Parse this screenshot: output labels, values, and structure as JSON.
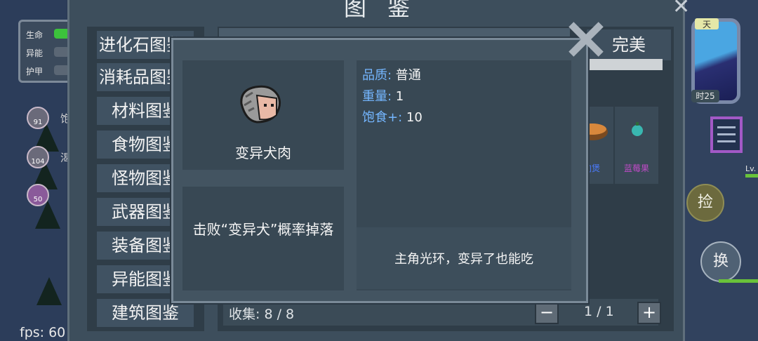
{
  "hud": {
    "status": [
      {
        "label": "生命",
        "color": "#3cc23c"
      },
      {
        "label": "异能",
        "color": "#5b6775"
      },
      {
        "label": "护甲",
        "color": "#5b6775"
      }
    ],
    "buffs": [
      {
        "value": "91",
        "side": "饱"
      },
      {
        "value": "104",
        "side": "渴"
      },
      {
        "value": "50",
        "side": ""
      }
    ],
    "fps": "fps: 60",
    "clock_top": "天",
    "clock_bottom": "时25",
    "pick_label": "捡",
    "swap_label": "换",
    "level_label": "Lv."
  },
  "codex": {
    "title": "图鉴",
    "categories": [
      "进化石图鉴",
      "消耗品图鉴",
      "材料图鉴",
      "食物图鉴",
      "怪物图鉴",
      "武器图鉴",
      "装备图鉴",
      "异能图鉴",
      "建筑图鉴"
    ],
    "perfect_tab": "完美",
    "progress": 1.0,
    "grid_items": [
      {
        "label": "肉煲",
        "label_color": "#4b7bff"
      },
      {
        "label": "蓝莓果",
        "label_color": "#c04bc8"
      }
    ],
    "collect": "收集: 8 / 8",
    "page_minus": "−",
    "page": "1 / 1",
    "page_plus": "+"
  },
  "detail": {
    "name": "变异犬肉",
    "source": "击败“变异犬”概率掉落",
    "stats": [
      {
        "key": "品质",
        "value": "普通"
      },
      {
        "key": "重量",
        "value": "1"
      },
      {
        "key": "饱食+",
        "value": "10"
      }
    ],
    "description": "主角光环，变异了也能吃",
    "icon": "dog-meat-icon"
  }
}
